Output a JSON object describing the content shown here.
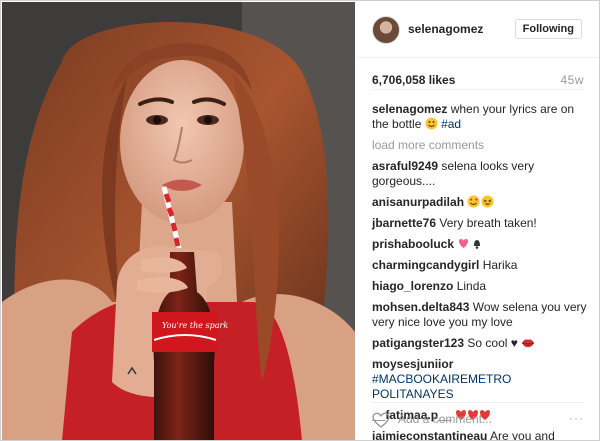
{
  "header": {
    "username": "selenagomez",
    "follow_label": "Following"
  },
  "stats": {
    "likes": "6,706,058 likes",
    "time": "45w"
  },
  "caption": {
    "user": "selenagomez",
    "text": "when your lyrics are on the bottle ",
    "emoji": "smile-emoji",
    "hashtag": "#ad"
  },
  "load_more": "load more comments",
  "comments": [
    {
      "user": "asraful9249",
      "text": "selena looks very gorgeous...."
    },
    {
      "user": "anisanurpadilah",
      "text": "",
      "emoji": "heart-eyes-and-laughing-emoji"
    },
    {
      "user": "jbarnette76",
      "text": "Very breath taken!"
    },
    {
      "user": "prishabooluck",
      "text": "",
      "emoji": "kiss-and-bell-emoji"
    },
    {
      "user": "charmingcandygirl",
      "text": "Harika"
    },
    {
      "user": "hiago_lorenzo",
      "text": "Linda"
    },
    {
      "user": "mohsen.delta843",
      "text": "Wow selena you very very nice love you my love"
    },
    {
      "user": "patigangster123",
      "text": "So cool ♥ ",
      "emoji": "lips-emoji"
    },
    {
      "user": "moysesjuniior",
      "text": "",
      "link": "#MACBOOKAIREMETRO POLITANAYES"
    },
    {
      "user": "__fatimaa.p__",
      "text": "",
      "emoji": "three-hearts-emoji"
    },
    {
      "user": "jaimieconstantineau",
      "text": "Are you and"
    }
  ],
  "footer": {
    "placeholder": "Add a comment...",
    "more": "···"
  },
  "bottle_label": "You're the spark"
}
